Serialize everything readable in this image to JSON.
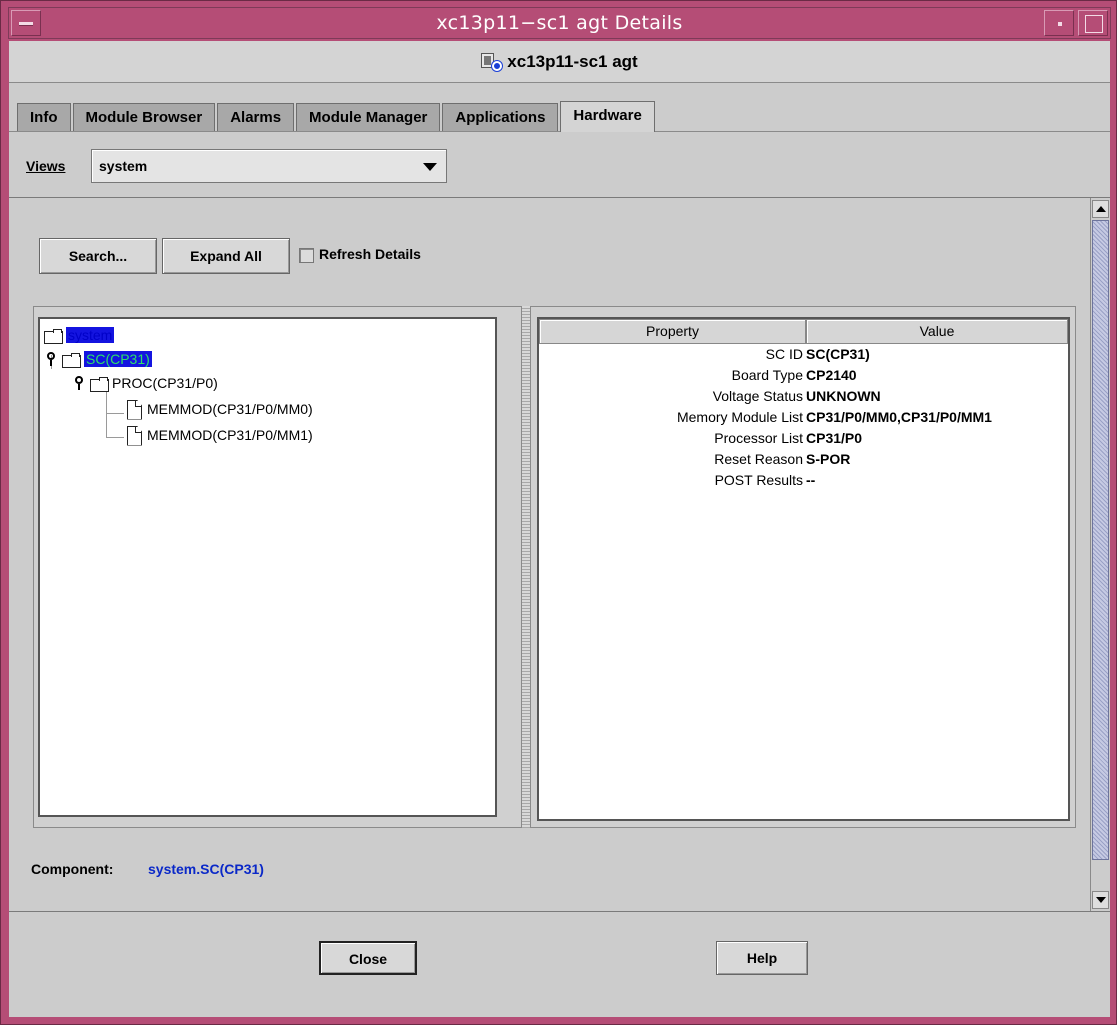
{
  "window": {
    "title": "xc13p11−sc1 agt Details"
  },
  "header": {
    "title": "xc13p11-sc1 agt"
  },
  "tabs": [
    {
      "label": "Info"
    },
    {
      "label": "Module Browser"
    },
    {
      "label": "Alarms"
    },
    {
      "label": "Module Manager"
    },
    {
      "label": "Applications"
    },
    {
      "label": "Hardware"
    }
  ],
  "views": {
    "label": "Views",
    "selected": "system"
  },
  "toolbar": {
    "search_label": "Search...",
    "expand_label": "Expand All",
    "refresh_label": "Refresh Details",
    "refresh_checked": false
  },
  "tree": {
    "nodes": [
      {
        "label": "system"
      },
      {
        "label": "SC(CP31)"
      },
      {
        "label": "PROC(CP31/P0)"
      },
      {
        "label": "MEMMOD(CP31/P0/MM0)"
      },
      {
        "label": "MEMMOD(CP31/P0/MM1)"
      }
    ]
  },
  "properties": {
    "headers": {
      "property": "Property",
      "value": "Value"
    },
    "rows": [
      {
        "name": "SC ID",
        "value": "SC(CP31)"
      },
      {
        "name": "Board Type",
        "value": "CP2140"
      },
      {
        "name": "Voltage Status",
        "value": "UNKNOWN"
      },
      {
        "name": "Memory Module List",
        "value": "CP31/P0/MM0,CP31/P0/MM1"
      },
      {
        "name": "Processor List",
        "value": "CP31/P0"
      },
      {
        "name": "Reset Reason",
        "value": "S-POR"
      },
      {
        "name": "POST Results",
        "value": "--"
      }
    ]
  },
  "component": {
    "label": "Component:",
    "value": "system.SC(CP31)"
  },
  "footer": {
    "close_label": "Close",
    "help_label": "Help"
  },
  "colors": {
    "frame": "#b54d76",
    "selection_bg": "#1414e0",
    "selection_text": "#2de06a",
    "component_value": "#0a28c8"
  }
}
